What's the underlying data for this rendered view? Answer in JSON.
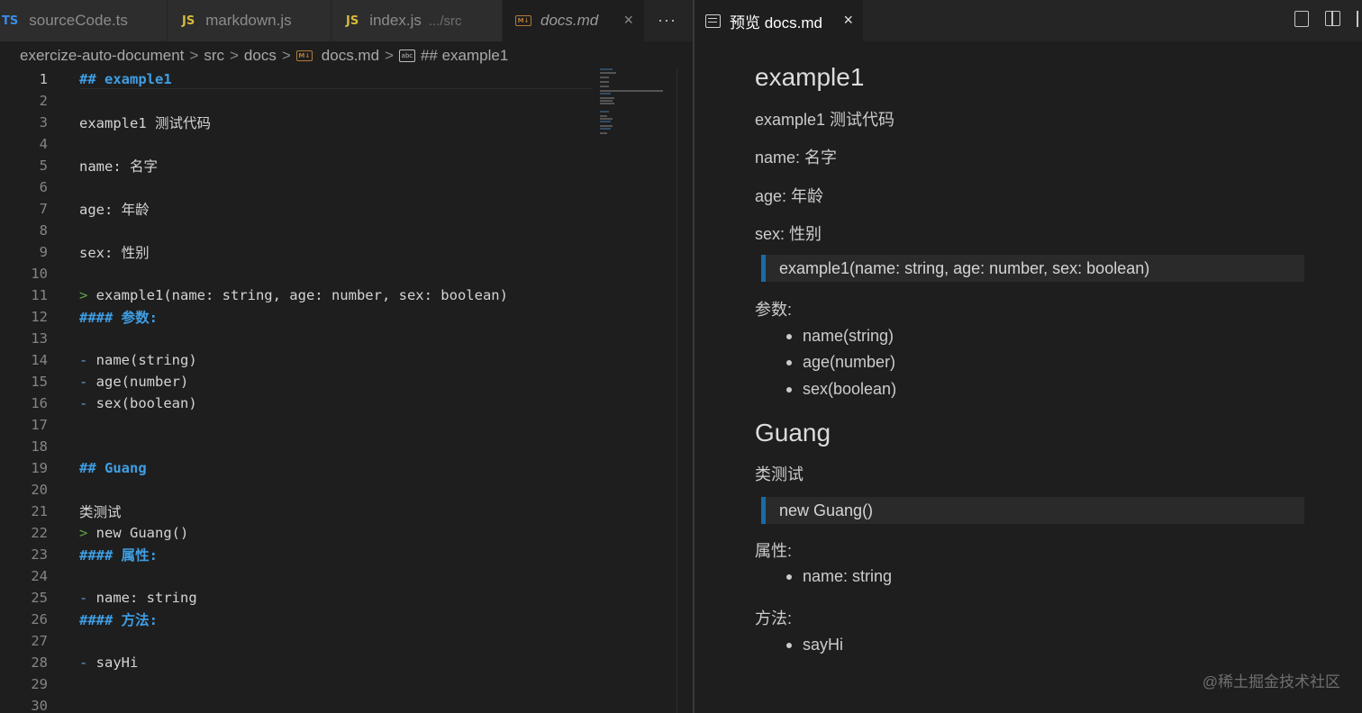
{
  "left_tabs": [
    {
      "badge": "TS",
      "label": "sourceCode.ts"
    },
    {
      "badge": "JS",
      "label": "markdown.js"
    },
    {
      "badge": "JS",
      "label": "index.js",
      "description": ".../src"
    },
    {
      "badge": "M↓",
      "label": "docs.md",
      "close": "×"
    }
  ],
  "more_actions": "···",
  "breadcrumb": {
    "items": [
      "exercize-auto-document",
      "src",
      "docs",
      "docs.md",
      "## example1"
    ],
    "separator": ">"
  },
  "editor": {
    "lines": [
      {
        "n": "1",
        "text": "## example1"
      },
      {
        "n": "2",
        "text": ""
      },
      {
        "n": "3",
        "text": "example1 测试代码"
      },
      {
        "n": "4",
        "text": ""
      },
      {
        "n": "5",
        "text": "name: 名字"
      },
      {
        "n": "6",
        "text": ""
      },
      {
        "n": "7",
        "text": "age: 年龄"
      },
      {
        "n": "8",
        "text": ""
      },
      {
        "n": "9",
        "text": "sex: 性别"
      },
      {
        "n": "10",
        "text": ""
      },
      {
        "n": "11",
        "prefix": ">",
        "text": " example1(name: string, age: number, sex: boolean)"
      },
      {
        "n": "12",
        "text": "#### 参数:"
      },
      {
        "n": "13",
        "text": ""
      },
      {
        "n": "14",
        "prefix": "-",
        "text": " name(string)"
      },
      {
        "n": "15",
        "prefix": "-",
        "text": " age(number)"
      },
      {
        "n": "16",
        "prefix": "-",
        "text": " sex(boolean)"
      },
      {
        "n": "17",
        "text": ""
      },
      {
        "n": "18",
        "text": ""
      },
      {
        "n": "19",
        "text": "## Guang"
      },
      {
        "n": "20",
        "text": ""
      },
      {
        "n": "21",
        "text": "类测试"
      },
      {
        "n": "22",
        "prefix": ">",
        "text": " new Guang()"
      },
      {
        "n": "23",
        "text": "#### 属性:"
      },
      {
        "n": "24",
        "text": ""
      },
      {
        "n": "25",
        "prefix": "-",
        "text": " name: string"
      },
      {
        "n": "26",
        "text": "#### 方法:"
      },
      {
        "n": "27",
        "text": ""
      },
      {
        "n": "28",
        "prefix": "-",
        "text": " sayHi"
      },
      {
        "n": "29",
        "text": ""
      },
      {
        "n": "30",
        "text": ""
      }
    ]
  },
  "preview_tab": {
    "label": "预览 docs.md",
    "close": "×"
  },
  "preview": {
    "h_example1": "example1",
    "p_desc1": "example1 测试代码",
    "p_name": "name: 名字",
    "p_age": "age: 年龄",
    "p_sex": "sex: 性别",
    "quote1": "example1(name: string, age: number, sex: boolean)",
    "params_label": "参数:",
    "params": [
      "name(string)",
      "age(number)",
      "sex(boolean)"
    ],
    "h_guang": "Guang",
    "p_desc2": "类测试",
    "quote2": "new Guang()",
    "props_label": "属性:",
    "props": [
      "name: string"
    ],
    "methods_label": "方法:",
    "methods": [
      "sayHi"
    ]
  },
  "watermark": "@稀土掘金技术社区",
  "colors": {
    "heading": "#3f9ee3",
    "quote_marker": "#5ea24a",
    "list_dash": "#5a9ddc",
    "blockquote_bar": "#1a6aa8",
    "ts_badge": "#3b8eea",
    "js_badge": "#d7ba3d"
  }
}
